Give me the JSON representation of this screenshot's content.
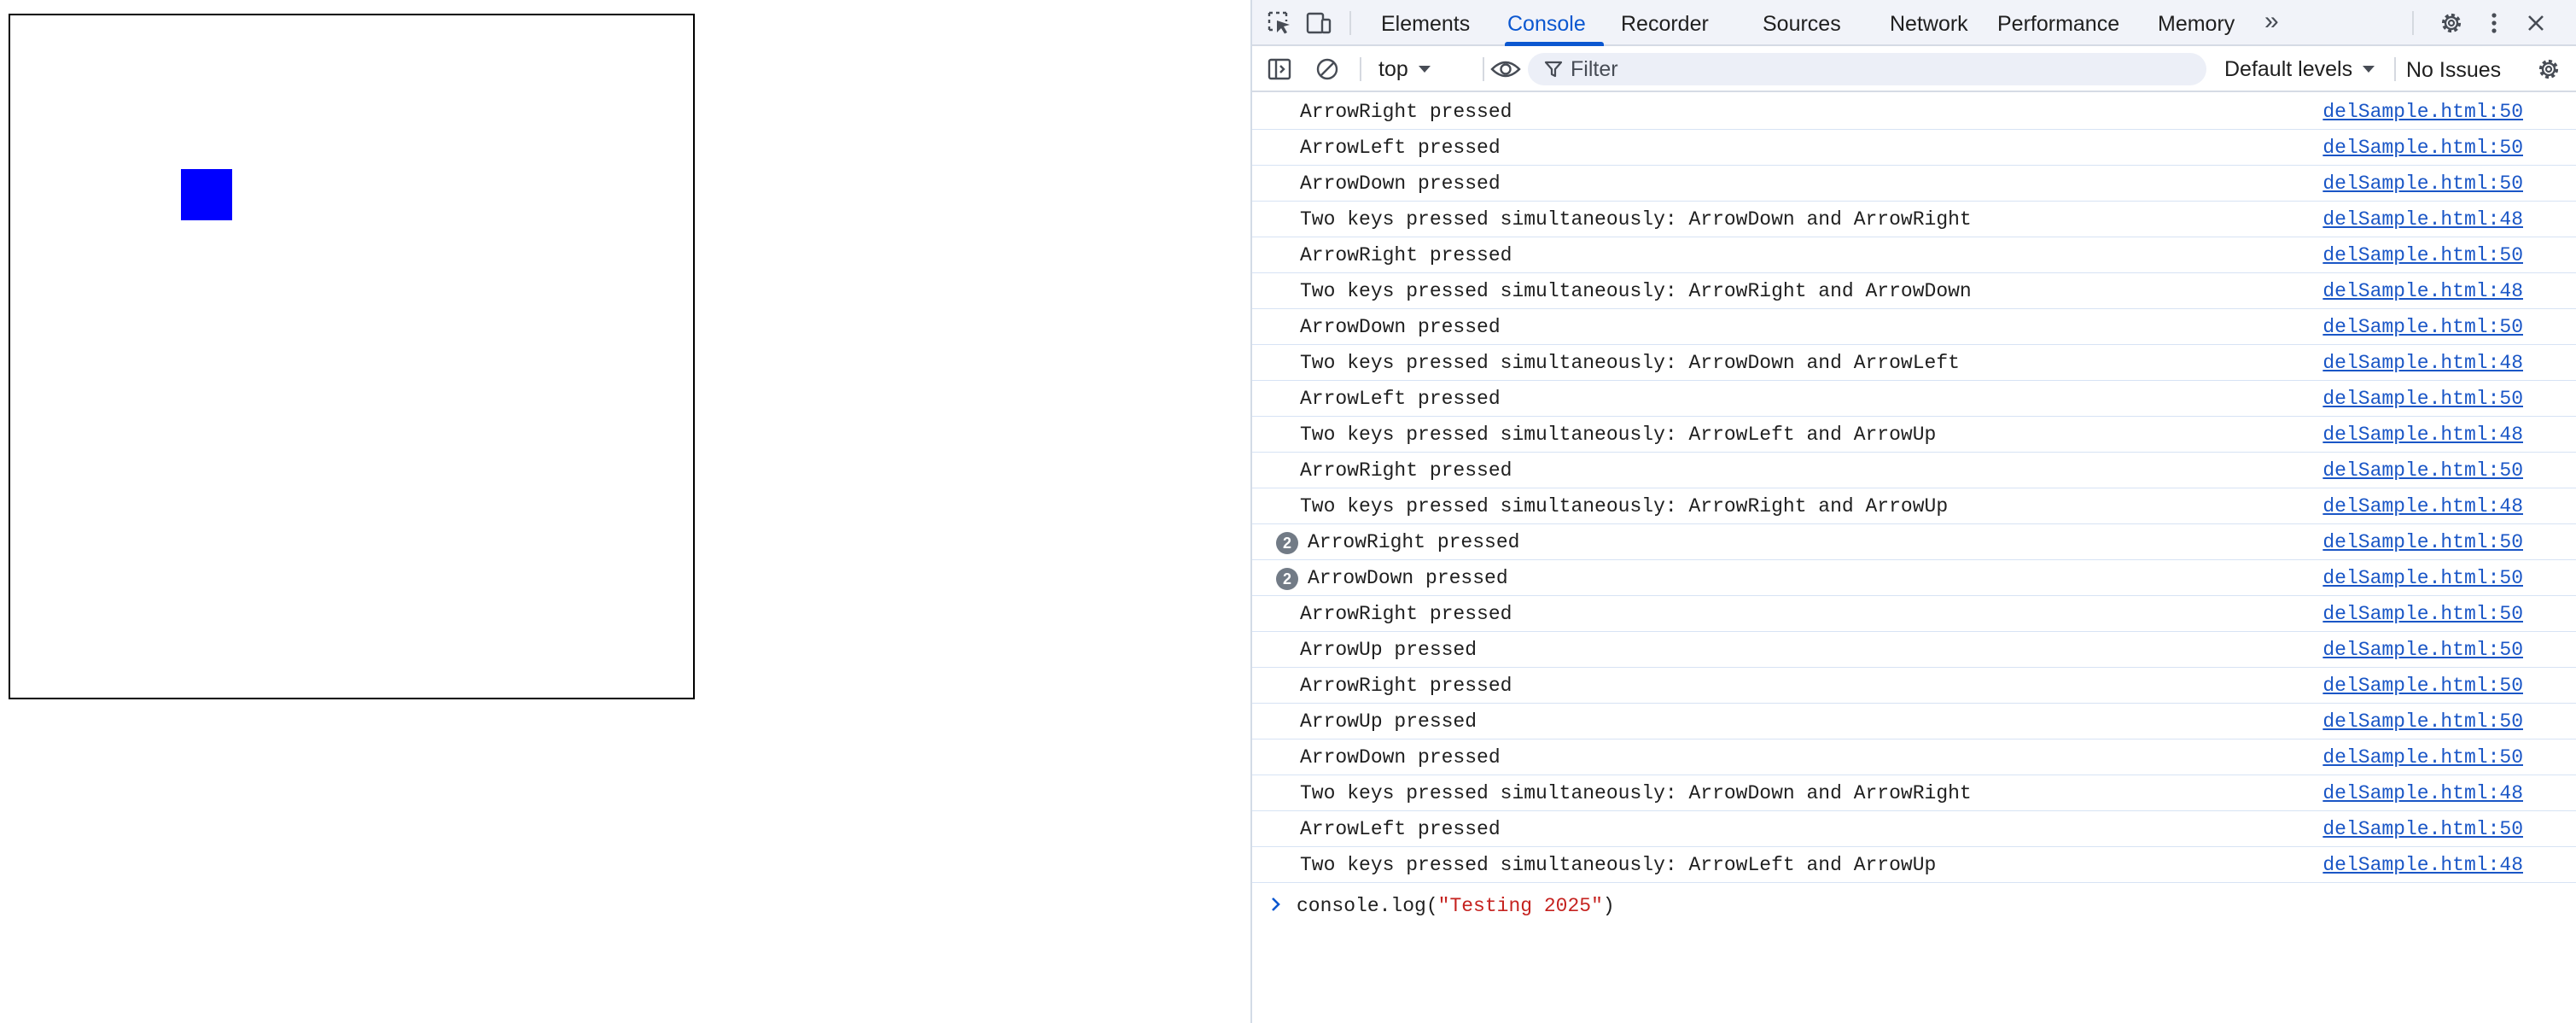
{
  "game": {
    "square_color": "#0000ff"
  },
  "devtools": {
    "tabs": [
      {
        "label": "Elements",
        "active": false
      },
      {
        "label": "Console",
        "active": true
      },
      {
        "label": "Recorder",
        "active": false
      },
      {
        "label": "Sources",
        "active": false
      },
      {
        "label": "Network",
        "active": false
      },
      {
        "label": "Performance",
        "active": false
      },
      {
        "label": "Memory",
        "active": false
      }
    ],
    "more_tabs_glyph": "»",
    "icons": [
      "inspect-element-icon",
      "device-toolbar-icon",
      "gear-icon",
      "kebab-menu-icon",
      "close-icon"
    ],
    "accent_color": "#0b57d0",
    "link_color": "#1a56c6",
    "string_color": "#c5221f",
    "toolbar": {
      "context": "top",
      "filter_placeholder": "Filter",
      "levels": "Default levels",
      "issues": "No Issues"
    },
    "messages": [
      {
        "text": "ArrowRight pressed",
        "source": "delSample.html:50"
      },
      {
        "text": "ArrowLeft pressed",
        "source": "delSample.html:50"
      },
      {
        "text": "ArrowDown pressed",
        "source": "delSample.html:50"
      },
      {
        "text": "Two keys pressed simultaneously: ArrowDown and ArrowRight",
        "source": "delSample.html:48"
      },
      {
        "text": "ArrowRight pressed",
        "source": "delSample.html:50"
      },
      {
        "text": "Two keys pressed simultaneously: ArrowRight and ArrowDown",
        "source": "delSample.html:48"
      },
      {
        "text": "ArrowDown pressed",
        "source": "delSample.html:50"
      },
      {
        "text": "Two keys pressed simultaneously: ArrowDown and ArrowLeft",
        "source": "delSample.html:48"
      },
      {
        "text": "ArrowLeft pressed",
        "source": "delSample.html:50"
      },
      {
        "text": "Two keys pressed simultaneously: ArrowLeft and ArrowUp",
        "source": "delSample.html:48"
      },
      {
        "text": "ArrowRight pressed",
        "source": "delSample.html:50"
      },
      {
        "text": "Two keys pressed simultaneously: ArrowRight and ArrowUp",
        "source": "delSample.html:48"
      },
      {
        "text": "ArrowRight pressed",
        "source": "delSample.html:50",
        "count": "2"
      },
      {
        "text": "ArrowDown pressed",
        "source": "delSample.html:50",
        "count": "2"
      },
      {
        "text": "ArrowRight pressed",
        "source": "delSample.html:50"
      },
      {
        "text": "ArrowUp pressed",
        "source": "delSample.html:50"
      },
      {
        "text": "ArrowRight pressed",
        "source": "delSample.html:50"
      },
      {
        "text": "ArrowUp pressed",
        "source": "delSample.html:50"
      },
      {
        "text": "ArrowDown pressed",
        "source": "delSample.html:50"
      },
      {
        "text": "Two keys pressed simultaneously: ArrowDown and ArrowRight",
        "source": "delSample.html:48"
      },
      {
        "text": "ArrowLeft pressed",
        "source": "delSample.html:50"
      },
      {
        "text": "Two keys pressed simultaneously: ArrowLeft and ArrowUp",
        "source": "delSample.html:48"
      }
    ],
    "prompt": {
      "prefix": "console.log(",
      "string": "\"Testing 2025\"",
      "suffix": ")"
    }
  }
}
